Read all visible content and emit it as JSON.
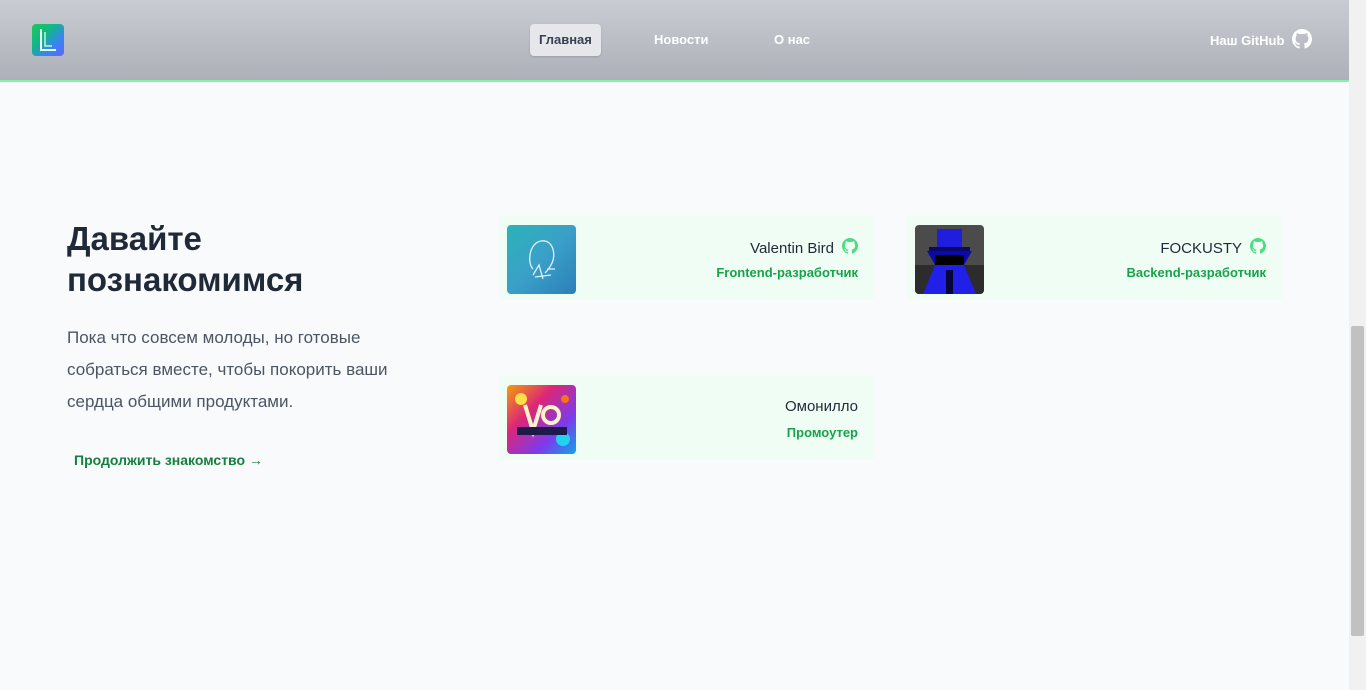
{
  "header": {
    "logo_icon": "logo-icon",
    "nav": [
      {
        "label": "Главная",
        "active": true
      },
      {
        "label": "Новости",
        "active": false
      },
      {
        "label": "О нас",
        "active": false
      }
    ],
    "github_label": "Наш GitHub",
    "github_icon": "github-icon",
    "accent_border": "#86efac"
  },
  "intro": {
    "title": "Давайте познакомимся",
    "text": "Пока что совсем молоды, но готовые собраться вместе, чтобы покорить ваши сердца общими продуктами.",
    "continue_link": "Продолжить знакомство →"
  },
  "team": [
    {
      "name": "Valentin Bird",
      "role": "Frontend-разработчик",
      "github_icon": "github-icon"
    },
    {
      "name": "FOCKUSTY",
      "role": "Backend-разработчик",
      "github_icon": "github-icon"
    },
    {
      "name": "Омонилло",
      "role": "Промоутер"
    }
  ],
  "colors": {
    "card_bg": "#f0fdf4",
    "role_text": "#16a34a",
    "link_text": "#15803d",
    "page_bg": "#f8fafc"
  }
}
